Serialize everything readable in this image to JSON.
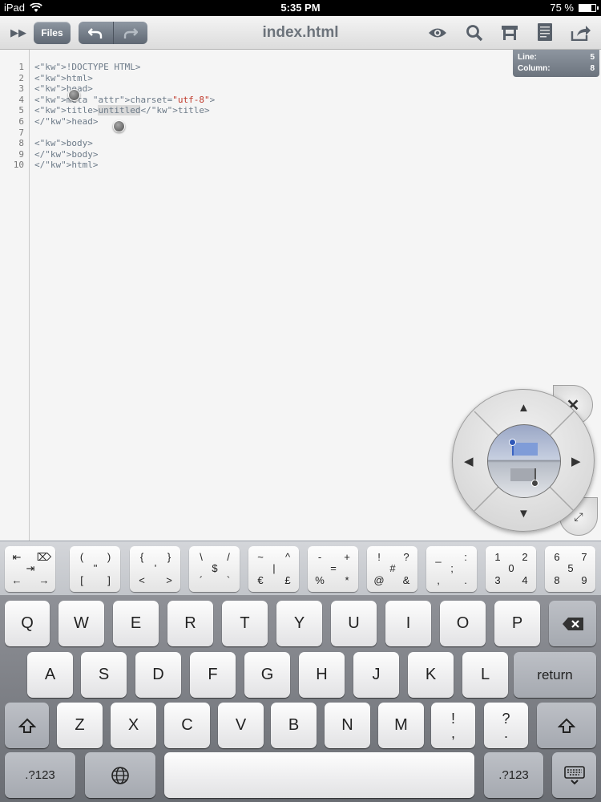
{
  "status_bar": {
    "device": "iPad",
    "time": "5:35 PM",
    "battery": "75 %",
    "battery_level": 0.75
  },
  "toolbar": {
    "files_label": "Files",
    "title": "index.html",
    "undo_icon": "undo-icon",
    "redo_icon": "redo-icon",
    "icons": [
      "chevron-right-double-icon",
      "eye-icon",
      "search-icon",
      "hierarchy-icon",
      "document-icon",
      "share-icon"
    ]
  },
  "cursor_panel": {
    "line_label": "Line:",
    "line_value": "5",
    "column_label": "Column:",
    "column_value": "8"
  },
  "editor": {
    "line_numbers": [
      "1",
      "2",
      "3",
      "4",
      "5",
      "6",
      "7",
      "8",
      "9",
      "10"
    ],
    "code": [
      "<!DOCTYPE HTML>",
      "<html>",
      "<head>",
      "<meta charset=\"utf-8\">",
      "<title>untitled</title>",
      "</head>",
      "",
      "<body>",
      "</body>",
      "</html>"
    ],
    "selected_text": "untitled"
  },
  "extra_keys": [
    {
      "name": "tab-keys",
      "glyphs": [
        "⇤",
        "⌦",
        "⇥",
        "←",
        "→"
      ]
    },
    {
      "name": "parens-keys",
      "glyphs": [
        "(",
        ")",
        "\"",
        "[",
        "]"
      ]
    },
    {
      "name": "braces-keys",
      "glyphs": [
        "{",
        "}",
        "'",
        "<",
        ">"
      ]
    },
    {
      "name": "slash-keys",
      "glyphs": [
        "\\",
        "/",
        "$",
        "´",
        "`"
      ]
    },
    {
      "name": "tilde-keys",
      "glyphs": [
        "~",
        "^",
        "|",
        "€",
        "£"
      ]
    },
    {
      "name": "math-keys",
      "glyphs": [
        "-",
        "+",
        "=",
        "%",
        "*"
      ]
    },
    {
      "name": "punct-keys",
      "glyphs": [
        "!",
        "?",
        "#",
        "@",
        "&"
      ]
    },
    {
      "name": "colon-keys",
      "glyphs": [
        "_",
        ":",
        ";",
        ",",
        "."
      ]
    },
    {
      "name": "digits-1-4-keys",
      "glyphs": [
        "1",
        "2",
        "0",
        "3",
        "4"
      ]
    },
    {
      "name": "digits-5-9-keys",
      "glyphs": [
        "6",
        "7",
        "5",
        "8",
        "9"
      ]
    }
  ],
  "keyboard": {
    "row1": [
      "Q",
      "W",
      "E",
      "R",
      "T",
      "Y",
      "U",
      "I",
      "O",
      "P"
    ],
    "row2": [
      "A",
      "S",
      "D",
      "F",
      "G",
      "H",
      "J",
      "K",
      "L"
    ],
    "row3": [
      "Z",
      "X",
      "C",
      "V",
      "B",
      "N",
      "M"
    ],
    "return_label": "return",
    "exclaim_key": [
      "!",
      ","
    ],
    "question_key": [
      "?",
      "."
    ],
    "numbers_label": ".?123"
  }
}
